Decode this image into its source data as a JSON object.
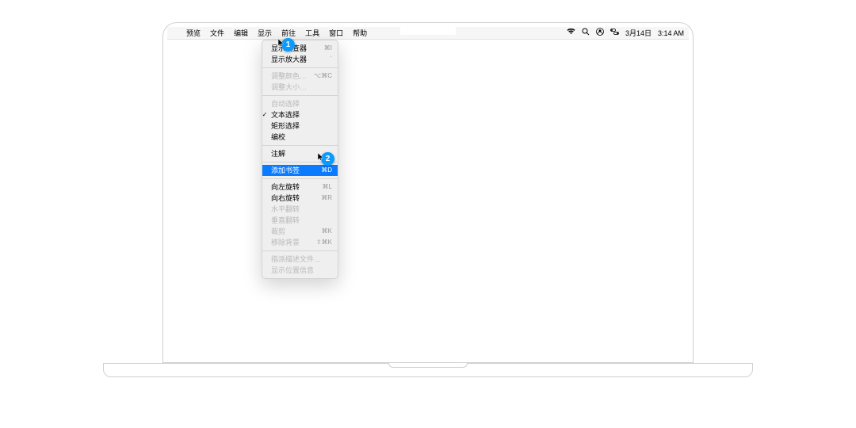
{
  "menubar": {
    "apple": "",
    "items": [
      "预览",
      "文件",
      "编辑",
      "显示",
      "前往",
      "工具",
      "窗口",
      "帮助"
    ],
    "right": {
      "wifi": "wifi",
      "search": "search",
      "user": "user",
      "control": "control",
      "date": "3月14日",
      "time": "3:14 AM"
    }
  },
  "dropdown": {
    "items": [
      {
        "label": "显示检查器",
        "shortcut": "⌘I",
        "disabled": false
      },
      {
        "label": "显示放大器",
        "shortcut": "`",
        "disabled": false
      },
      {
        "sep": true
      },
      {
        "label": "调整颜色…",
        "shortcut": "⌥⌘C",
        "disabled": true
      },
      {
        "label": "调整大小…",
        "shortcut": "",
        "disabled": true
      },
      {
        "sep": true
      },
      {
        "label": "自动选择",
        "shortcut": "",
        "disabled": true
      },
      {
        "label": "文本选择",
        "shortcut": "",
        "disabled": false,
        "checked": true
      },
      {
        "label": "矩形选择",
        "shortcut": "",
        "disabled": false
      },
      {
        "label": "编校",
        "shortcut": "",
        "disabled": false
      },
      {
        "sep": true
      },
      {
        "label": "注解",
        "shortcut": "",
        "disabled": false,
        "submenu": true
      },
      {
        "sep": true
      },
      {
        "label": "添加书签",
        "shortcut": "⌘D",
        "disabled": false,
        "highlight": true
      },
      {
        "sep": true
      },
      {
        "label": "向左旋转",
        "shortcut": "⌘L",
        "disabled": false
      },
      {
        "label": "向右旋转",
        "shortcut": "⌘R",
        "disabled": false
      },
      {
        "label": "水平翻转",
        "shortcut": "",
        "disabled": true
      },
      {
        "label": "垂直翻转",
        "shortcut": "",
        "disabled": true
      },
      {
        "label": "裁剪",
        "shortcut": "⌘K",
        "disabled": true
      },
      {
        "label": "移除背景",
        "shortcut": "⇧⌘K",
        "disabled": true
      },
      {
        "sep": true
      },
      {
        "label": "指派描述文件…",
        "shortcut": "",
        "disabled": true
      },
      {
        "label": "显示位置信息",
        "shortcut": "",
        "disabled": true
      }
    ]
  },
  "badges": {
    "b1": "1",
    "b2": "2"
  }
}
